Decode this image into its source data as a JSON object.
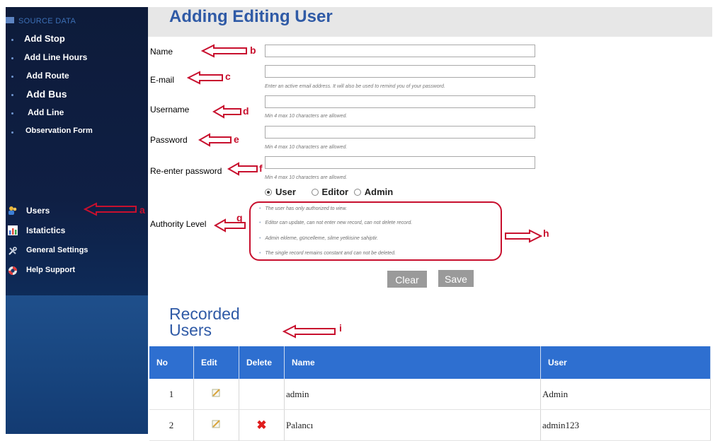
{
  "sidebar": {
    "section_title": "SOURCE DATA",
    "source_items": [
      {
        "label": "Add Stop"
      },
      {
        "label": "Add Line Hours"
      },
      {
        "label": "Add Route"
      },
      {
        "label": "Add Bus"
      },
      {
        "label": "Add Line"
      },
      {
        "label": "Observation Form"
      }
    ],
    "main_items": [
      {
        "label": "Users",
        "icon": "users-icon"
      },
      {
        "label": "Istatictics",
        "icon": "chart-icon"
      },
      {
        "label": "General Settings",
        "icon": "tools-icon"
      },
      {
        "label": "Help Support",
        "icon": "lifebuoy-icon"
      }
    ]
  },
  "header": {
    "title": "Adding Editing User"
  },
  "form": {
    "name_label": "Name",
    "email_label": "E-mail",
    "email_hint": "Enter an active email address. It will also be used to remind you of your password.",
    "username_label": "Username",
    "username_hint": "Min 4 max 10 characters are allowed.",
    "password_label": "Password",
    "password_hint": "Min 4 max 10 characters are allowed.",
    "reenter_label": "Re-enter password",
    "reenter_hint": "Min 4 max 10 characters are allowed.",
    "authority_label": "Authority Level",
    "roles": [
      {
        "label": "User",
        "selected": true
      },
      {
        "label": "Editor",
        "selected": false
      },
      {
        "label": "Admin",
        "selected": false
      }
    ],
    "authority_desc": [
      "The user has only authorized to view.",
      "Editor can update, can not enter new record, can not delete record.",
      "Admin ekleme, güncelleme, silme yetkisine sahiptir.",
      "The single record remains constant and can not be deleted."
    ],
    "clear_label": "Clear",
    "save_label": "Save"
  },
  "annotations": {
    "a": "a",
    "b": "b",
    "c": "c",
    "d": "d",
    "e": "e",
    "f": "f",
    "g": "g",
    "h": "h",
    "i": "i",
    "color": "#c8102e"
  },
  "recorded": {
    "title_line1": "Recorded",
    "title_line2": "Users",
    "columns": [
      "No",
      "Edit",
      "Delete",
      "Name",
      "User"
    ],
    "rows": [
      {
        "no": "1",
        "name": "admin",
        "user": "Admin",
        "deletable": false
      },
      {
        "no": "2",
        "name": "Palancı",
        "user": "admin123",
        "deletable": true
      }
    ]
  },
  "colors": {
    "accent": "#2f5aa6",
    "table_header": "#2e6fd0",
    "sidebar": "#0d1b3a"
  }
}
